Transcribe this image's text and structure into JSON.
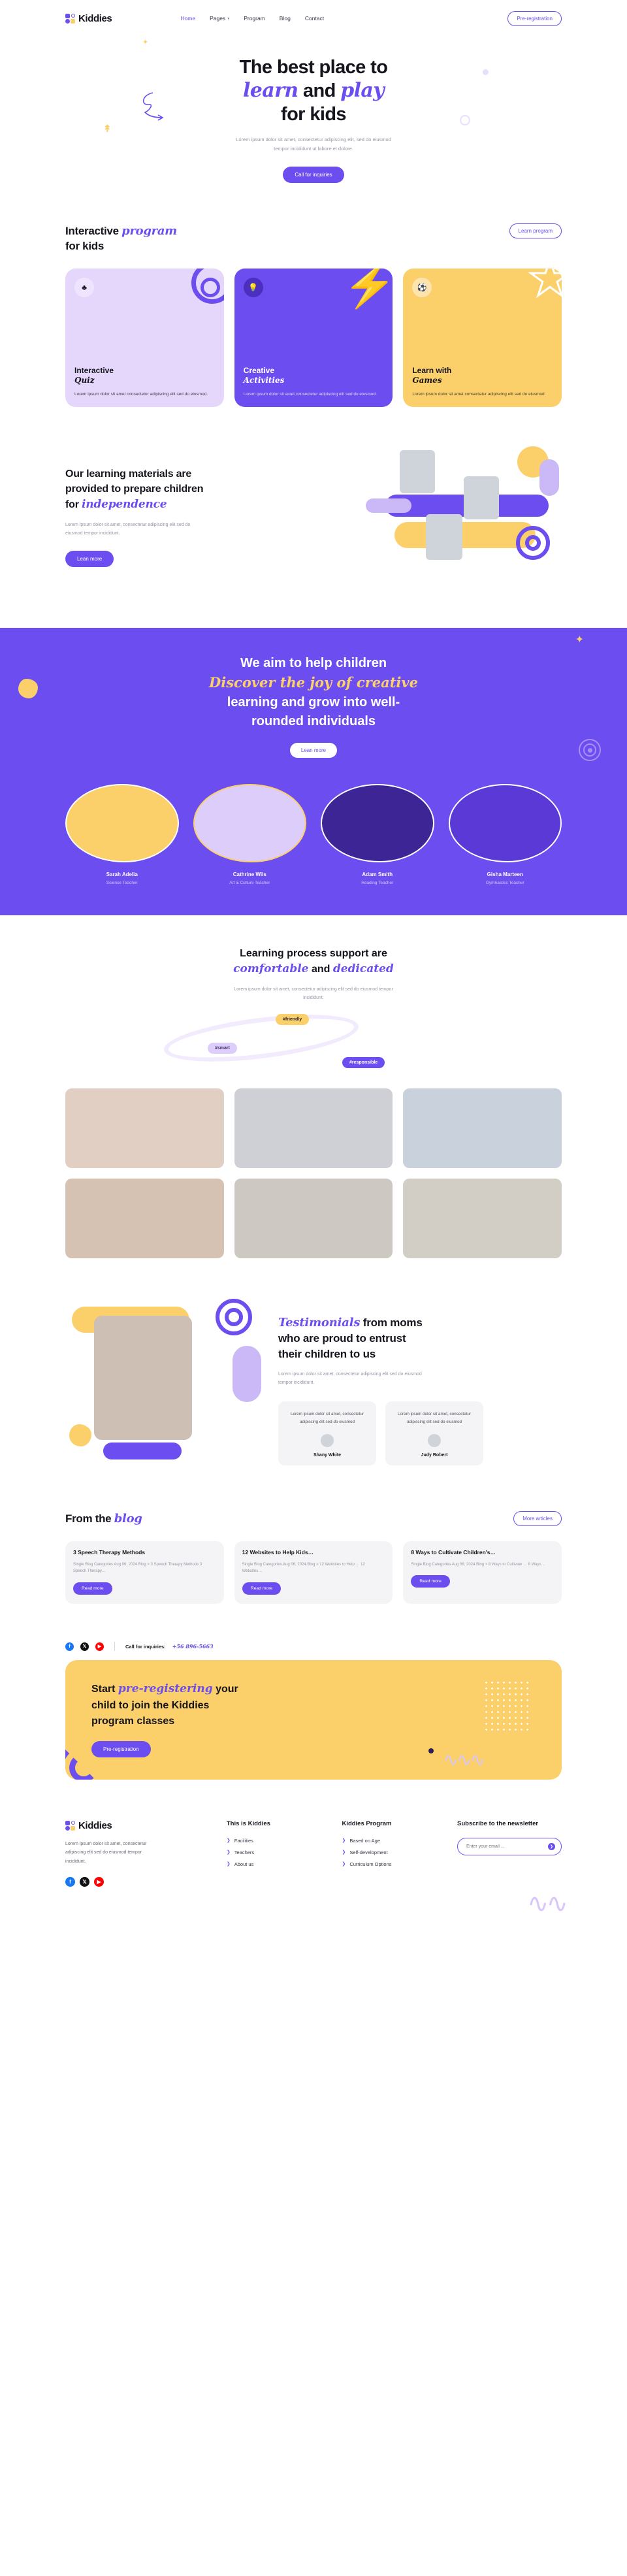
{
  "brand": {
    "name": "Kiddies"
  },
  "nav": {
    "links": [
      {
        "label": "Home",
        "active": true
      },
      {
        "label": "Pages",
        "caret": "⌄"
      },
      {
        "label": "Program"
      },
      {
        "label": "Blog"
      },
      {
        "label": "Contact"
      }
    ],
    "cta": "Pre-registration"
  },
  "hero": {
    "line1": "The best place to",
    "line2a": "learn",
    "line2b": " and ",
    "line2c": "play",
    "line3": "for kids",
    "sub": "Lorem ipsum dolor sit amet, consectetur adipiscing elit, sed do eiusmod tempor incididunt ut labore et dolore.",
    "cta": "Call for inquiries"
  },
  "program": {
    "title_a": "Interactive ",
    "title_i": "program",
    "title_b": "for kids",
    "cta": "Learn program",
    "cards": [
      {
        "icon": "puzzle-icon",
        "glyph": "♣",
        "title": "Interactive",
        "title_i": "Quiz",
        "desc": "Lorem ipsum dolor sit amet consectetur adipiscing elit sed do eiusmod."
      },
      {
        "icon": "lightbulb-icon",
        "glyph": "💡",
        "title": "Creative",
        "title_i": "Activities",
        "desc": "Lorem ipsum dolor sit amet consectetur adipiscing elit sed do eiusmod."
      },
      {
        "icon": "ball-icon",
        "glyph": "⚽",
        "title": "Learn with",
        "title_i": "Games",
        "desc": "Lorem ipsum dolor sit amet consectetur adipiscing elit sed do eiusmod."
      }
    ]
  },
  "materials": {
    "line1": "Our learning materials are",
    "line2": "provided to prepare children",
    "line3a": "for ",
    "line3i": "independence",
    "desc": "Lorem ipsum dolor sit amet, consectetur adipiscing elit sed do eiusmod tempor incididunt.",
    "cta": "Lean more"
  },
  "band": {
    "line1": "We aim to help children",
    "line2i": "Discover the joy of creative",
    "line3": "learning and grow into well-",
    "line4": "rounded individuals",
    "cta": "Lean more",
    "teachers": [
      {
        "name": "Sarah Adelia",
        "role": "Science Teacher"
      },
      {
        "name": "Cathrine Wils",
        "role": "Art & Culture Teacher"
      },
      {
        "name": "Adam Smith",
        "role": "Reading Teacher"
      },
      {
        "name": "Gisha Marteen",
        "role": "Gymnastics Teacher"
      }
    ]
  },
  "process": {
    "line1": "Learning process support are",
    "line2a": "comfortable",
    "line2b": " and ",
    "line2c": "dedicated",
    "desc": "Lorem ipsum dolor sit amet, consectetur adipiscing elit sed do eiusmod tempor incididunt.",
    "tags": [
      "#friendly",
      "#smart",
      "#responsible"
    ]
  },
  "testimonials": {
    "title_i": "Testimonials",
    "title_a": " from moms",
    "title_b": "who are proud to entrust",
    "title_c": "their children to us",
    "lead": "Lorem ipsum dolor sit amet, consectetur adipiscing elit sed do eiusmod tempor incididunt.",
    "items": [
      {
        "quote": "Lorem ipsum dolor sit amet, consectetur adipiscing elit sed do eiusmod",
        "name": "Shany White"
      },
      {
        "quote": "Lorem ipsum dolor sit amet, consectetur adipiscing elit sed do eiusmod",
        "name": "Judy Robert"
      }
    ]
  },
  "blog": {
    "title_a": "From the ",
    "title_i": "blog",
    "cta": "More articles",
    "posts": [
      {
        "title": "3 Speech Therapy Methods",
        "meta": "Single Blog Categories Aug 06, 2024 Blog > 3 Speech Therapy Methods 3 Speech Therapy…",
        "cta": "Read more"
      },
      {
        "title": "12 Websites to Help Kids…",
        "meta": "Single Blog Categories Aug 06, 2024 Blog > 12 Websites to Help … 12 Websites…",
        "cta": "Read more"
      },
      {
        "title": "8 Ways to Cultivate Children's…",
        "meta": "Single Blog Categories Aug 06, 2024 Blog > 8 Ways to Cultivate … 8 Ways…",
        "cta": "Read more"
      }
    ]
  },
  "contact": {
    "label": "Call for inquiries:",
    "phone": "+56 896-5663",
    "socials": [
      "facebook-icon",
      "x-icon",
      "youtube-icon"
    ]
  },
  "cta_box": {
    "line1a": "Start ",
    "line1i": "pre-registering",
    "line1b": " your",
    "line2": "child to join the Kiddies",
    "line3": "program classes",
    "button": "Pre-registration"
  },
  "footer": {
    "desc": "Lorem ipsum dolor sit amet, consectetur adipiscing elit sed do eiusmod tempor incididunt.",
    "col2": {
      "head": "This is Kiddies",
      "links": [
        "Facilities",
        "Teachers",
        "About us"
      ]
    },
    "col3": {
      "head": "Kiddies Program",
      "links": [
        "Based on Age",
        "Self-development",
        "Curriculum Options"
      ]
    },
    "col4": {
      "head": "Subscribe to the newsletter",
      "placeholder": "Enter your email ..."
    }
  },
  "colors": {
    "purple": "#6c4df0",
    "yellow": "#fbd06b",
    "lavender": "#e4d7fb",
    "dark": "#16141c"
  }
}
